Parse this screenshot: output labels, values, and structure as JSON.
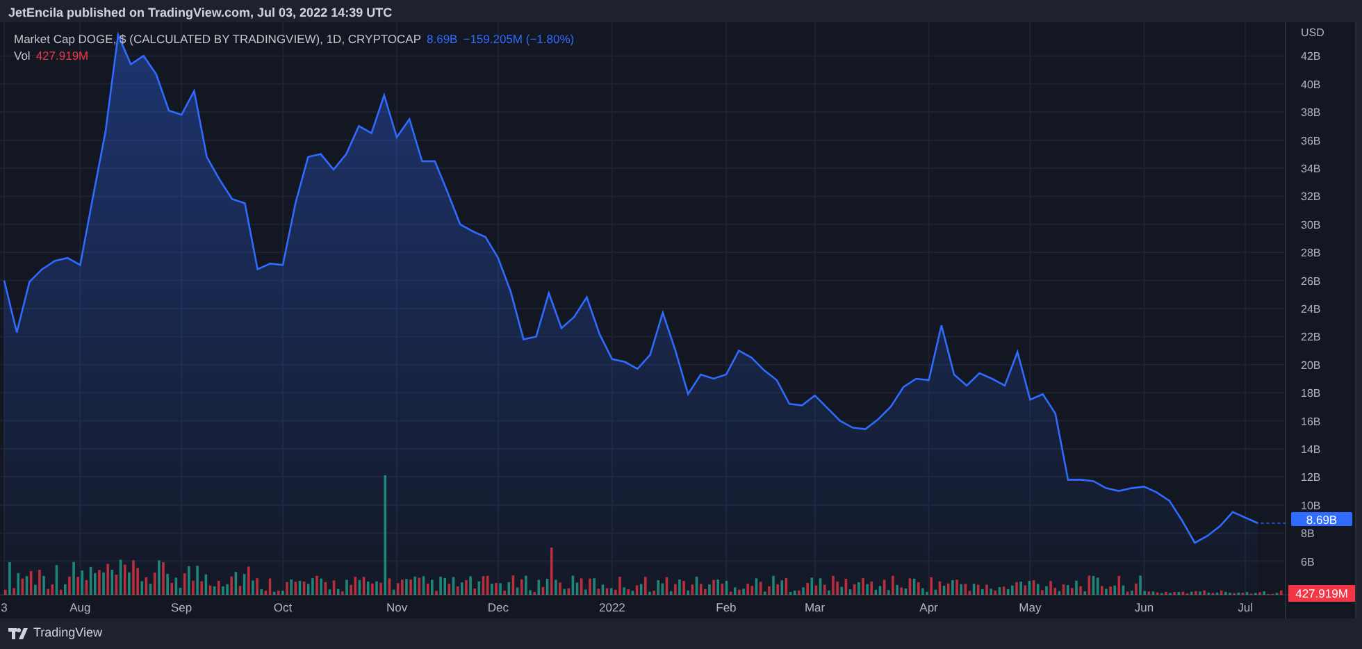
{
  "header": {
    "text": "JetEncila published on TradingView.com, Jul 03, 2022 14:39 UTC"
  },
  "legend": {
    "title": "Market Cap DOGE, $ (CALCULATED BY TRADINGVIEW), 1D, CRYPTOCAP",
    "value": "8.69B",
    "change": "−159.205M (−1.80%)",
    "volume_label": "Vol",
    "volume_value": "427.919M"
  },
  "chart_data": {
    "type": "area",
    "grid": true,
    "ylim": [
      3.6,
      44.4
    ],
    "yticks": [
      {
        "value": 6,
        "label": "6B"
      },
      {
        "value": 8,
        "label": "8B"
      },
      {
        "value": 10,
        "label": "10B"
      },
      {
        "value": 12,
        "label": "12B"
      },
      {
        "value": 14,
        "label": "14B"
      },
      {
        "value": 16,
        "label": "16B"
      },
      {
        "value": 18,
        "label": "18B"
      },
      {
        "value": 20,
        "label": "20B"
      },
      {
        "value": 22,
        "label": "22B"
      },
      {
        "value": 24,
        "label": "24B"
      },
      {
        "value": 26,
        "label": "26B"
      },
      {
        "value": 28,
        "label": "28B"
      },
      {
        "value": 30,
        "label": "30B"
      },
      {
        "value": 32,
        "label": "32B"
      },
      {
        "value": 34,
        "label": "34B"
      },
      {
        "value": 36,
        "label": "36B"
      },
      {
        "value": 38,
        "label": "38B"
      },
      {
        "value": 40,
        "label": "40B"
      },
      {
        "value": 42,
        "label": "42B"
      }
    ],
    "categories": [
      "3",
      null,
      null,
      null,
      null,
      null,
      "Aug",
      null,
      null,
      null,
      null,
      null,
      null,
      null,
      "Sep",
      null,
      null,
      null,
      null,
      null,
      null,
      null,
      "Oct",
      null,
      null,
      null,
      null,
      null,
      null,
      null,
      null,
      "Nov",
      null,
      null,
      null,
      null,
      null,
      null,
      null,
      "Dec",
      null,
      null,
      null,
      null,
      null,
      null,
      null,
      null,
      "2022",
      null,
      null,
      null,
      null,
      null,
      null,
      null,
      null,
      "Feb",
      null,
      null,
      null,
      null,
      null,
      null,
      "Mar",
      null,
      null,
      null,
      null,
      null,
      null,
      null,
      null,
      "Apr",
      null,
      null,
      null,
      null,
      null,
      null,
      null,
      "May",
      null,
      null,
      null,
      null,
      null,
      null,
      null,
      null,
      "Jun",
      null,
      null,
      null,
      null,
      null,
      null,
      null,
      "Jul",
      null
    ],
    "series": [
      {
        "color": "#2f6bff",
        "values": [
          26.0,
          22.3,
          25.9,
          26.8,
          27.4,
          27.6,
          27.1,
          31.9,
          36.6,
          43.5,
          41.4,
          42.0,
          40.7,
          38.1,
          37.8,
          39.5,
          34.8,
          33.2,
          31.8,
          31.5,
          26.8,
          27.2,
          27.1,
          31.5,
          34.8,
          35.0,
          33.9,
          35.0,
          37.0,
          36.5,
          39.2,
          36.2,
          37.5,
          34.5,
          34.5,
          32.3,
          30.0,
          29.5,
          29.1,
          27.6,
          25.2,
          21.8,
          22.0,
          25.1,
          22.6,
          23.4,
          24.8,
          22.2,
          20.4,
          20.2,
          19.7,
          20.7,
          23.7,
          21.0,
          17.9,
          19.3,
          19.0,
          19.3,
          21.0,
          20.5,
          19.6,
          18.9,
          17.2,
          17.1,
          17.8,
          16.9,
          16.0,
          15.5,
          15.4,
          16.1,
          17.0,
          18.4,
          19.0,
          18.9,
          22.8,
          19.3,
          18.5,
          19.4,
          19.0,
          18.5,
          20.9,
          17.5,
          17.9,
          16.5,
          11.8,
          11.8,
          11.7,
          11.2,
          11.0,
          11.2,
          11.3,
          10.9,
          10.3,
          8.9,
          7.3,
          7.8,
          8.5,
          9.5,
          9.1,
          8.7
        ]
      }
    ]
  },
  "axis_unit": "USD",
  "price_badge": "8.69B",
  "volume_badge": "427.919M",
  "footer": {
    "brand": "TradingView"
  }
}
